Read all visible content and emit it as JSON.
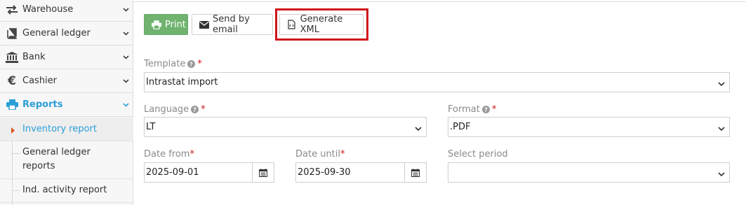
{
  "sidebar": {
    "items": [
      {
        "label": "Warehouse",
        "icon": "arrows-exchange-icon"
      },
      {
        "label": "General ledger",
        "icon": "book-icon"
      },
      {
        "label": "Bank",
        "icon": "bank-icon"
      },
      {
        "label": "Cashier",
        "icon": "euro-icon"
      },
      {
        "label": "Reports",
        "icon": "printer-icon"
      }
    ],
    "subitems": [
      {
        "label": "Inventory report"
      },
      {
        "label": "General ledger\nreports"
      },
      {
        "label": "Ind. activity report"
      }
    ]
  },
  "toolbar": {
    "print_label": "Print",
    "email_label": "Send by email",
    "xml_label": "Generate XML"
  },
  "form": {
    "template": {
      "label": "Template",
      "value": "Intrastat import"
    },
    "language": {
      "label": "Language",
      "value": "LT"
    },
    "format": {
      "label": "Format",
      "value": ".PDF"
    },
    "date_from": {
      "label": "Date from",
      "value": "2025-09-01"
    },
    "date_until": {
      "label": "Date until",
      "value": "2025-09-30"
    },
    "period": {
      "label": "Select period",
      "value": ""
    },
    "required_mark": "*"
  },
  "colors": {
    "accent": "#2a9fd8",
    "print_button": "#6fb36f",
    "highlight": "#d0141a"
  }
}
